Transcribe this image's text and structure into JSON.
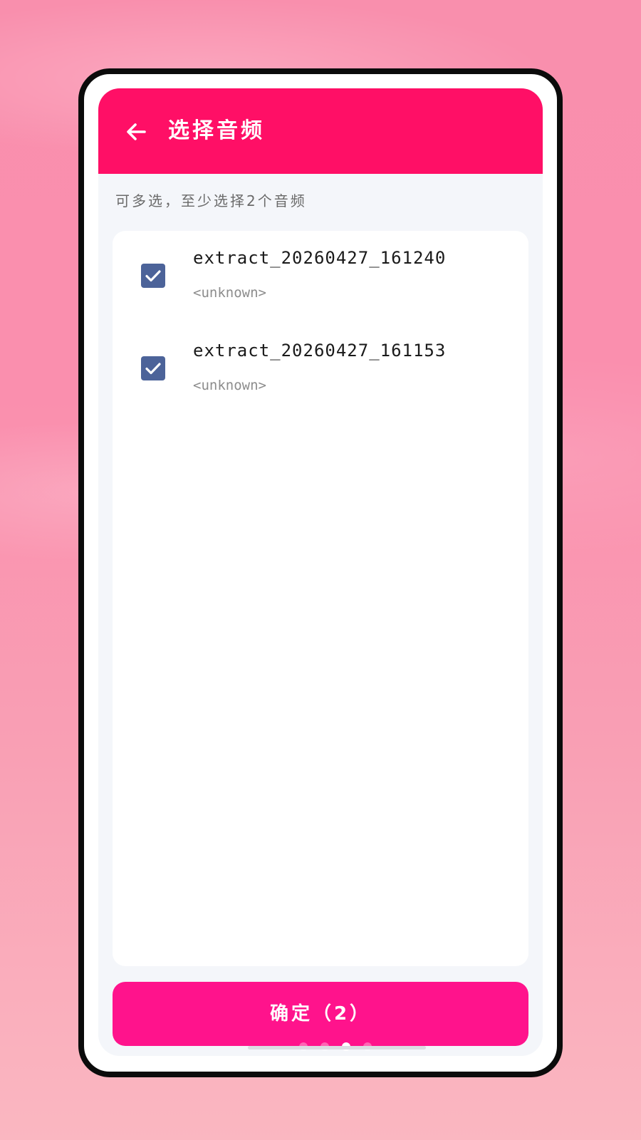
{
  "colors": {
    "background": "#fa8fae",
    "app_bar": "#ff0f66",
    "checkbox": "#4c6399",
    "confirm_button": "#ff138c",
    "phone_frame": "#0b0b0b"
  },
  "app_bar": {
    "back_icon": "arrow-left-icon",
    "title": "选择音频"
  },
  "hint": "可多选，至少选择2个音频",
  "audio_list": [
    {
      "name": "extract_20260427_161240",
      "artist": "<unknown>",
      "checked": true
    },
    {
      "name": "extract_20260427_161153",
      "artist": "<unknown>",
      "checked": true
    }
  ],
  "confirm_button": {
    "label": "确定（2）"
  },
  "page_indicator": {
    "count": 4,
    "active_index": 2
  }
}
